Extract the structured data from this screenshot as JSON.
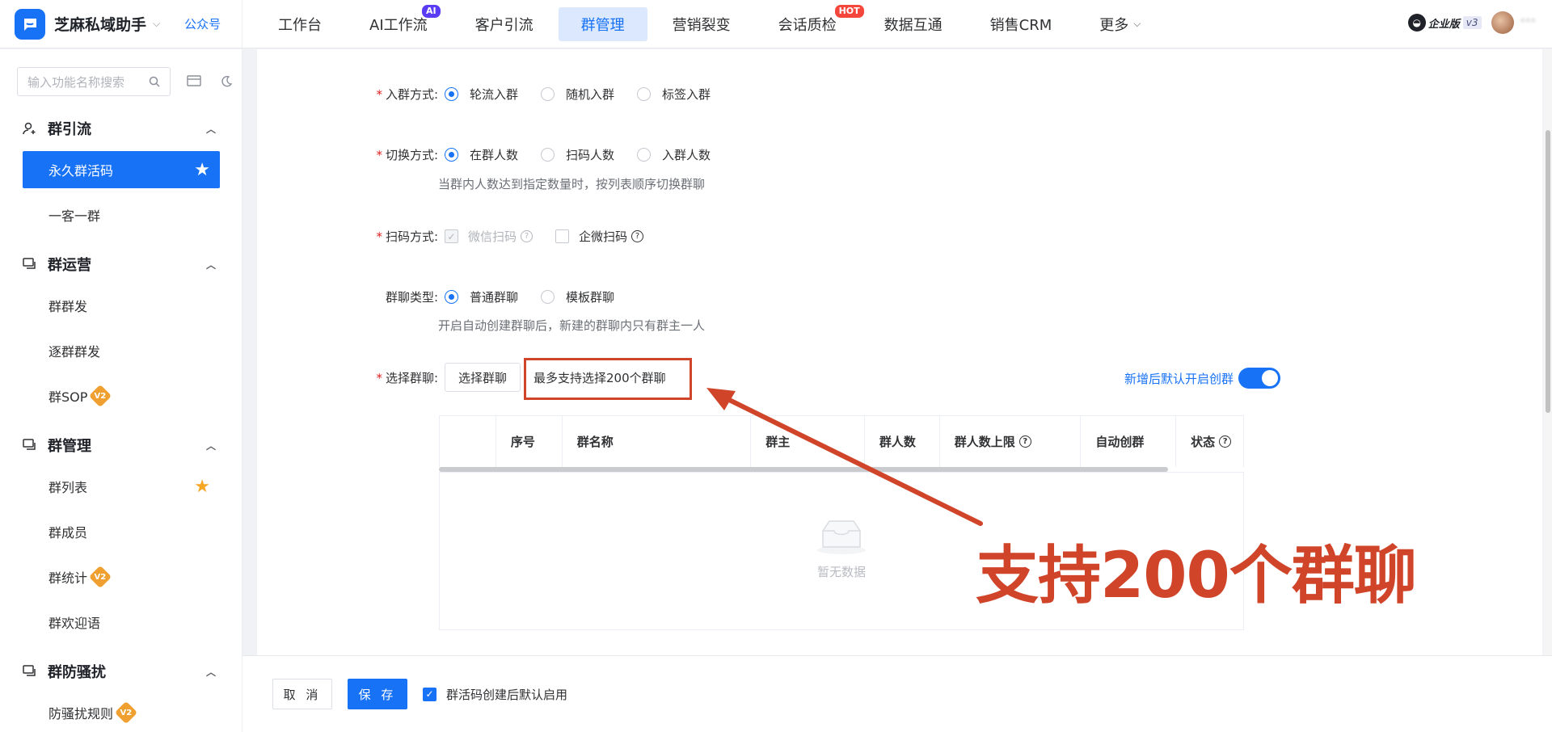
{
  "brand": {
    "name": "芝麻私域助手",
    "link": "公众号"
  },
  "nav": [
    {
      "label": "工作台"
    },
    {
      "label": "AI工作流",
      "badge": "AI"
    },
    {
      "label": "客户引流"
    },
    {
      "label": "群管理",
      "active": true
    },
    {
      "label": "营销裂变"
    },
    {
      "label": "会话质检",
      "badge": "HOT"
    },
    {
      "label": "数据互通"
    },
    {
      "label": "销售CRM"
    },
    {
      "label": "更多"
    }
  ],
  "account": {
    "edition": "企业版",
    "version": "v3",
    "user": "***"
  },
  "sidebar": {
    "search_placeholder": "输入功能名称搜索",
    "groups": [
      {
        "title": "群引流",
        "items": [
          {
            "label": "永久群活码",
            "active": true,
            "star": true
          },
          {
            "label": "一客一群"
          }
        ]
      },
      {
        "title": "群运营",
        "items": [
          {
            "label": "群群发"
          },
          {
            "label": "逐群群发"
          },
          {
            "label": "群SOP",
            "v2": true
          }
        ]
      },
      {
        "title": "群管理",
        "items": [
          {
            "label": "群列表",
            "star": true
          },
          {
            "label": "群成员"
          },
          {
            "label": "群统计",
            "v2": true
          },
          {
            "label": "群欢迎语"
          }
        ]
      },
      {
        "title": "群防骚扰",
        "items": [
          {
            "label": "防骚扰规则",
            "v2": true
          }
        ]
      }
    ],
    "badge_v2": "V2"
  },
  "form": {
    "join_mode": {
      "label": "入群方式:",
      "options": [
        "轮流入群",
        "随机入群",
        "标签入群"
      ]
    },
    "switch_mode": {
      "label": "切换方式:",
      "options": [
        "在群人数",
        "扫码人数",
        "入群人数"
      ],
      "hint": "当群内人数达到指定数量时，按列表顺序切换群聊"
    },
    "scan_mode": {
      "label": "扫码方式:",
      "options": [
        "微信扫码",
        "企微扫码"
      ]
    },
    "chat_type": {
      "label": "群聊类型:",
      "options": [
        "普通群聊",
        "模板群聊"
      ],
      "hint": "开启自动创建群聊后，新建的群聊内只有群主一人"
    },
    "select_chat": {
      "label": "选择群聊:",
      "button": "选择群聊",
      "hint": "最多支持选择200个群聊"
    },
    "auto_create_toggle": "新增后默认开启创群"
  },
  "table": {
    "headers": [
      "",
      "序号",
      "群名称",
      "群主",
      "群人数",
      "群人数上限",
      "自动创群",
      "状态"
    ],
    "empty": "暂无数据"
  },
  "annotation": "支持200个群聊",
  "footer": {
    "cancel": "取 消",
    "save": "保 存",
    "check_label": "群活码创建后默认启用"
  },
  "colors": {
    "primary": "#1772f6",
    "annotation": "#d0452a",
    "required": "#e02020"
  }
}
